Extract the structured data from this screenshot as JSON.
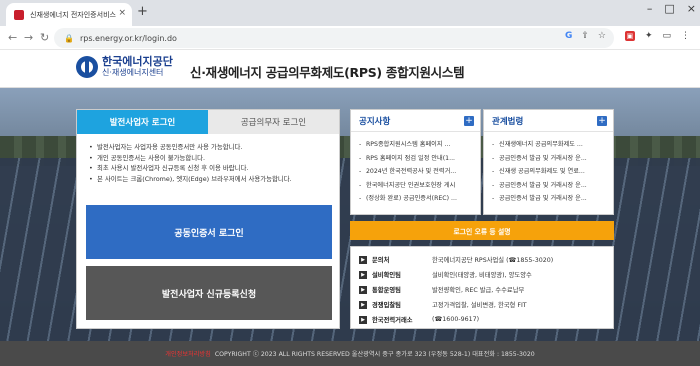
{
  "browser": {
    "tab_title": "신재생에너지 전자인증서비스",
    "tab_close": "×",
    "new_tab": "+",
    "window_buttons": [
      "–",
      "□",
      "×"
    ],
    "nav": {
      "back": "←",
      "forward": "→",
      "reload": "↻"
    },
    "url": "rps.energy.or.kr/login.do",
    "omni_icons": [
      "G",
      "⇪",
      "☆"
    ],
    "ext_icons": [
      "▣",
      "✦",
      "▭",
      "⋮"
    ]
  },
  "header": {
    "org_name": "한국에너지공단",
    "org_sub": "신·재생에너지센터",
    "site_title": "신·재생에너지 공급의무화제도(RPS) 종합지원시스템"
  },
  "login": {
    "tabs": [
      {
        "label": "발전사업자 로그인",
        "active": true
      },
      {
        "label": "공급의무자 로그인",
        "active": false
      }
    ],
    "notices": [
      "발전사업자는 사업자용 공동인증서만 사용 가능합니다.",
      "개인 공동인증서는 사용이 불가능합니다.",
      "최초 사용시 발전사업자 신규등록 신청 후 이용 바랍니다.",
      "본 사이트는 크롬(Chrome), 엣지(Edge) 브라우저에서 사용가능합니다."
    ],
    "cert_button": "공동인증서 로그인",
    "register_button": "발전사업자 신규등록신청"
  },
  "notice_board": {
    "title": "공지사항",
    "items": [
      "RPS종합지원시스템 홈페이지 ...",
      "RPS 홈페이지 점검 일정 안내(1...",
      "2024년 한국전력공사 및 전력거...",
      "한국에너지공단 인권보호헌장 게시",
      "(정상화 완료) 공급인증서(REC) ..."
    ]
  },
  "law_board": {
    "title": "관계법령",
    "items": [
      "신재생에너지 공급의무화제도 ...",
      "공급인증서 발급 및 거래시장 운...",
      "신재생 공급의무화제도 및 연료...",
      "공급인증서 발급 및 거래시장 운...",
      "공급인증서 발급 및 거래시장 운..."
    ]
  },
  "manual_button": "로그인 오류 등 설명",
  "contacts": [
    {
      "label": "문의처",
      "value": "한국에너지공단 RPS사업실 (☎1855-3020)"
    },
    {
      "label": "설비확인팀",
      "value": "설비확인(태양광, 비태양광), 양도양수"
    },
    {
      "label": "통합운영팀",
      "value": "발전량확인, REC 발급, 수수료납부"
    },
    {
      "label": "경쟁입찰팀",
      "value": "고정가격입찰, 설비변경, 한국형 FIT"
    },
    {
      "label": "한국전력거래소",
      "value": "(☎1600-9617)"
    }
  ],
  "footer": {
    "policy": "개인정보처리방침",
    "copyright": "COPYRIGHT ⓒ 2023 ALL RIGHTS RESERVED 울산광역시 중구 종가로 323 (우정동 528-1) 대표전화 : 1855-3020"
  },
  "colors": {
    "accent_blue": "#1ea3df",
    "cert_button": "#2f6cc3",
    "register_button": "#575757",
    "manual_button": "#f6a20b",
    "brand_blue": "#1a4fa0"
  }
}
